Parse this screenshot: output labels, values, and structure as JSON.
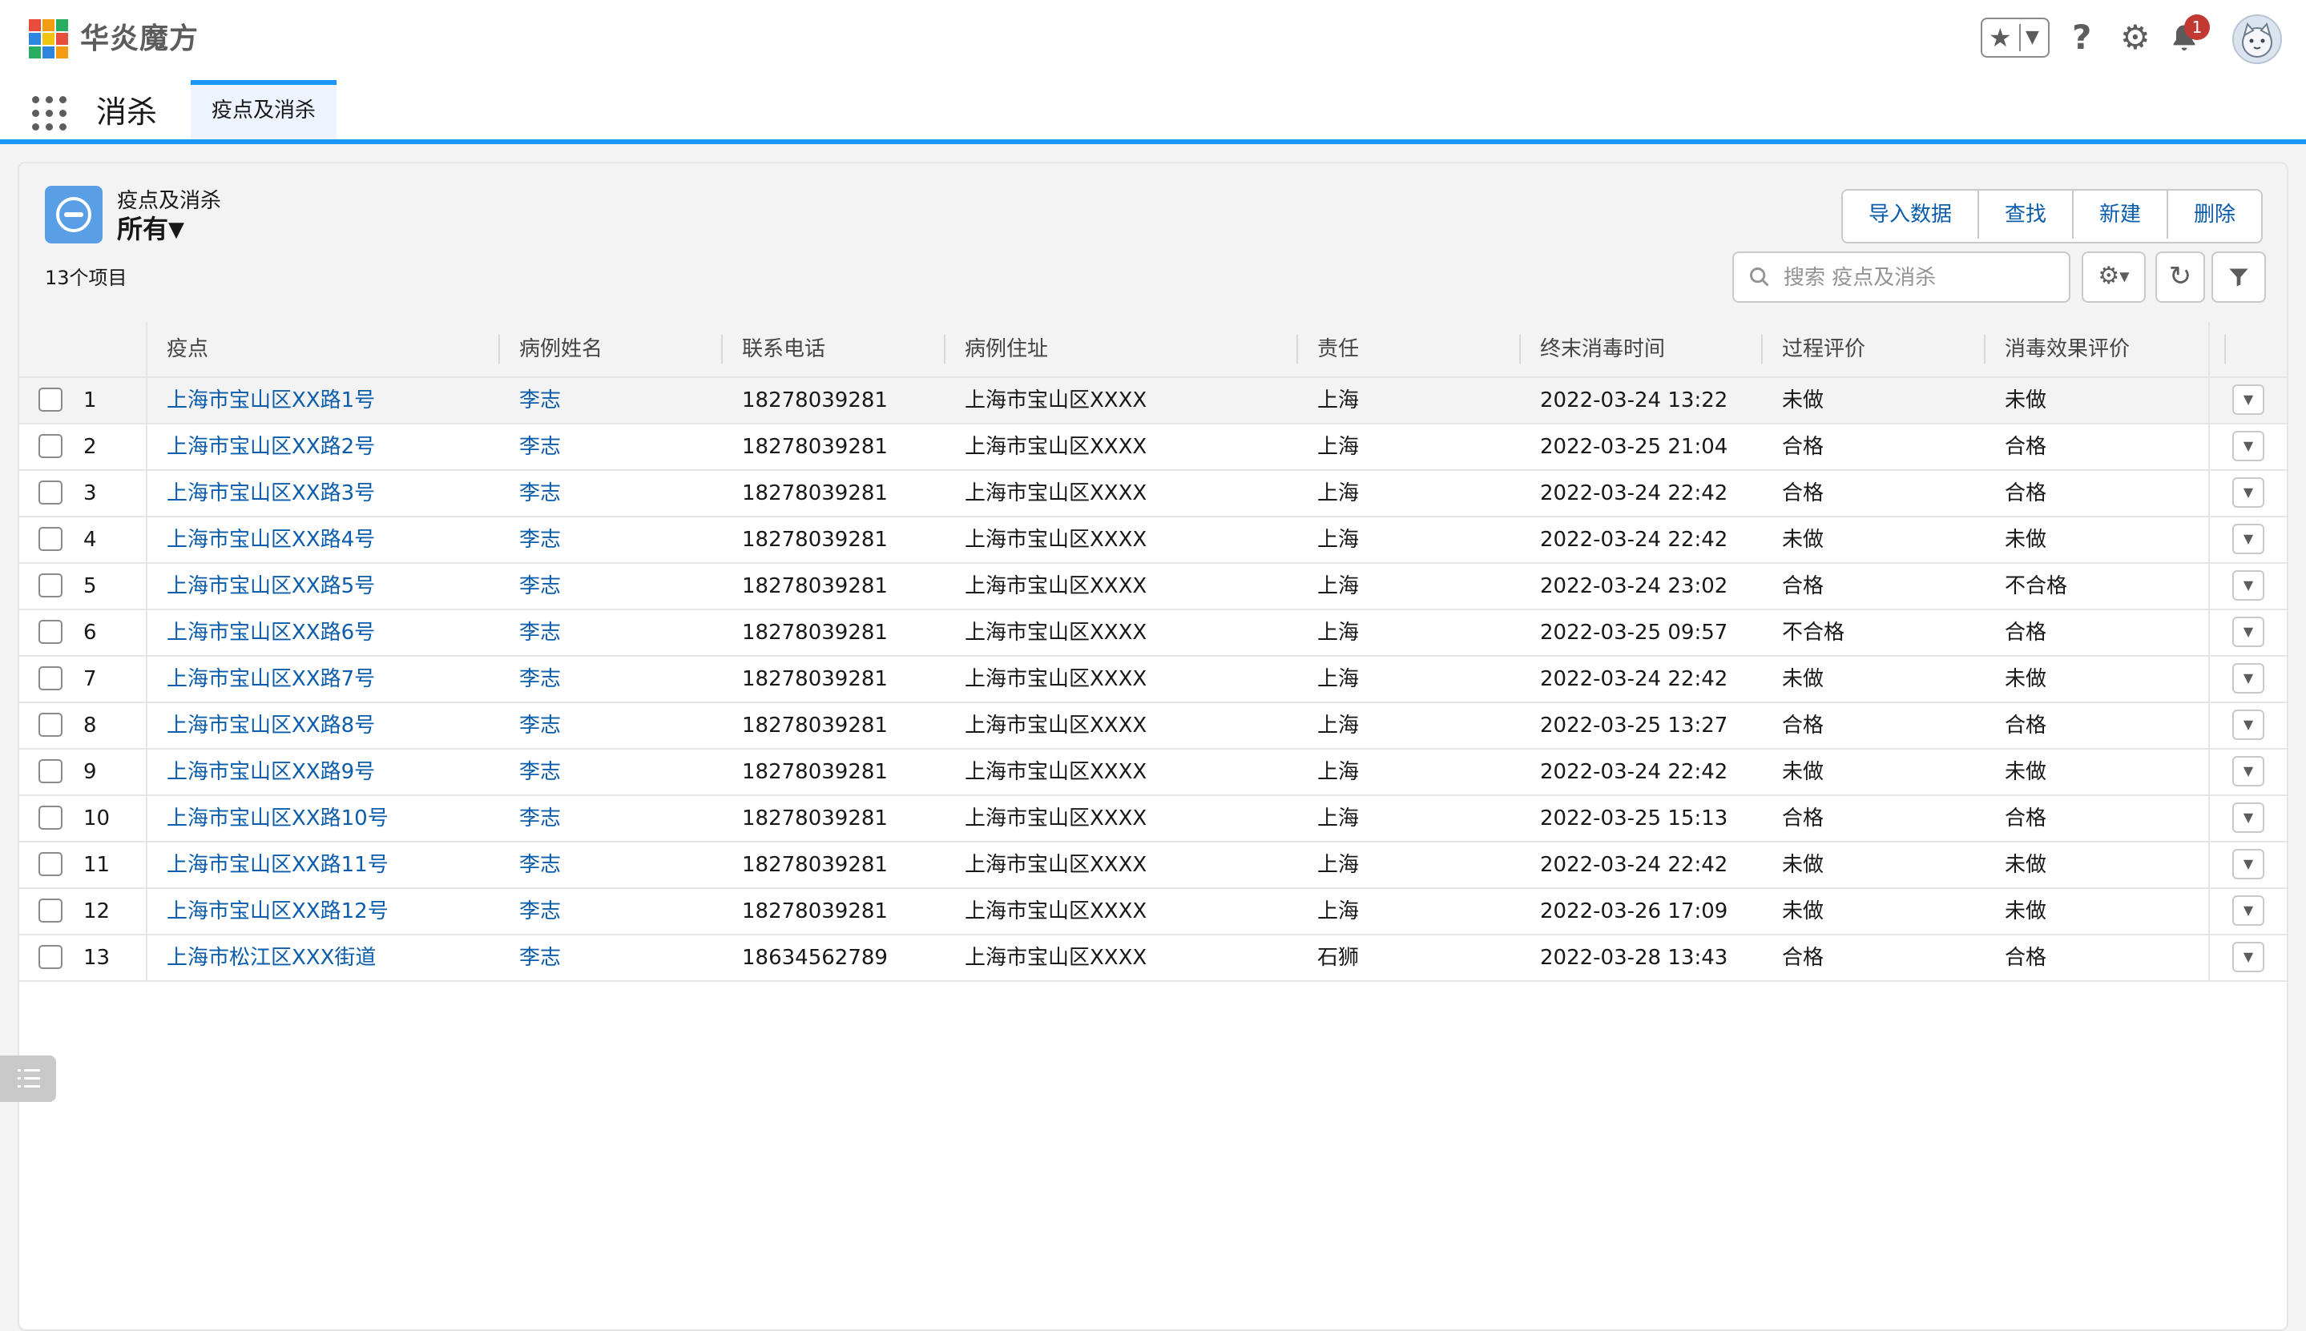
{
  "header": {
    "brand": "华炎魔方",
    "notification_count": "1",
    "icons": [
      "favorites-star-icon",
      "help-icon",
      "gear-icon",
      "bell-icon",
      "avatar"
    ]
  },
  "nav": {
    "app_name": "消杀",
    "tabs": [
      {
        "label": "疫点及消杀",
        "active": true
      }
    ]
  },
  "list": {
    "object_label": "疫点及消杀",
    "view_name": "所有",
    "item_count": "13个项目",
    "actions": [
      "导入数据",
      "查找",
      "新建",
      "删除"
    ],
    "search_placeholder": "搜索 疫点及消杀",
    "columns": [
      "疫点",
      "病例姓名",
      "联系电话",
      "病例住址",
      "责任",
      "终末消毒时间",
      "过程评价",
      "消毒效果评价"
    ],
    "rows": [
      {
        "n": "1",
        "site": "上海市宝山区XX路1号",
        "name": "李志",
        "phone": "18278039281",
        "addr": "上海市宝山区XXXX",
        "resp": "上海",
        "time": "2022-03-24 13:22",
        "proc": "未做",
        "eff": "未做"
      },
      {
        "n": "2",
        "site": "上海市宝山区XX路2号",
        "name": "李志",
        "phone": "18278039281",
        "addr": "上海市宝山区XXXX",
        "resp": "上海",
        "time": "2022-03-25 21:04",
        "proc": "合格",
        "eff": "合格"
      },
      {
        "n": "3",
        "site": "上海市宝山区XX路3号",
        "name": "李志",
        "phone": "18278039281",
        "addr": "上海市宝山区XXXX",
        "resp": "上海",
        "time": "2022-03-24 22:42",
        "proc": "合格",
        "eff": "合格"
      },
      {
        "n": "4",
        "site": "上海市宝山区XX路4号",
        "name": "李志",
        "phone": "18278039281",
        "addr": "上海市宝山区XXXX",
        "resp": "上海",
        "time": "2022-03-24 22:42",
        "proc": "未做",
        "eff": "未做"
      },
      {
        "n": "5",
        "site": "上海市宝山区XX路5号",
        "name": "李志",
        "phone": "18278039281",
        "addr": "上海市宝山区XXXX",
        "resp": "上海",
        "time": "2022-03-24 23:02",
        "proc": "合格",
        "eff": "不合格"
      },
      {
        "n": "6",
        "site": "上海市宝山区XX路6号",
        "name": "李志",
        "phone": "18278039281",
        "addr": "上海市宝山区XXXX",
        "resp": "上海",
        "time": "2022-03-25 09:57",
        "proc": "不合格",
        "eff": "合格"
      },
      {
        "n": "7",
        "site": "上海市宝山区XX路7号",
        "name": "李志",
        "phone": "18278039281",
        "addr": "上海市宝山区XXXX",
        "resp": "上海",
        "time": "2022-03-24 22:42",
        "proc": "未做",
        "eff": "未做"
      },
      {
        "n": "8",
        "site": "上海市宝山区XX路8号",
        "name": "李志",
        "phone": "18278039281",
        "addr": "上海市宝山区XXXX",
        "resp": "上海",
        "time": "2022-03-25 13:27",
        "proc": "合格",
        "eff": "合格"
      },
      {
        "n": "9",
        "site": "上海市宝山区XX路9号",
        "name": "李志",
        "phone": "18278039281",
        "addr": "上海市宝山区XXXX",
        "resp": "上海",
        "time": "2022-03-24 22:42",
        "proc": "未做",
        "eff": "未做"
      },
      {
        "n": "10",
        "site": "上海市宝山区XX路10号",
        "name": "李志",
        "phone": "18278039281",
        "addr": "上海市宝山区XXXX",
        "resp": "上海",
        "time": "2022-03-25 15:13",
        "proc": "合格",
        "eff": "合格"
      },
      {
        "n": "11",
        "site": "上海市宝山区XX路11号",
        "name": "李志",
        "phone": "18278039281",
        "addr": "上海市宝山区XXXX",
        "resp": "上海",
        "time": "2022-03-24 22:42",
        "proc": "未做",
        "eff": "未做"
      },
      {
        "n": "12",
        "site": "上海市宝山区XX路12号",
        "name": "李志",
        "phone": "18278039281",
        "addr": "上海市宝山区XXXX",
        "resp": "上海",
        "time": "2022-03-26 17:09",
        "proc": "未做",
        "eff": "未做"
      },
      {
        "n": "13",
        "site": "上海市松江区XXX街道",
        "name": "李志",
        "phone": "18634562789",
        "addr": "上海市宝山区XXXX",
        "resp": "石狮",
        "time": "2022-03-28 13:43",
        "proc": "合格",
        "eff": "合格"
      }
    ]
  },
  "colors": {
    "brand_blue": "#1b96ff",
    "link": "#0b5cab",
    "object_icon": "#5a9fe6",
    "badge_red": "#c23934"
  }
}
